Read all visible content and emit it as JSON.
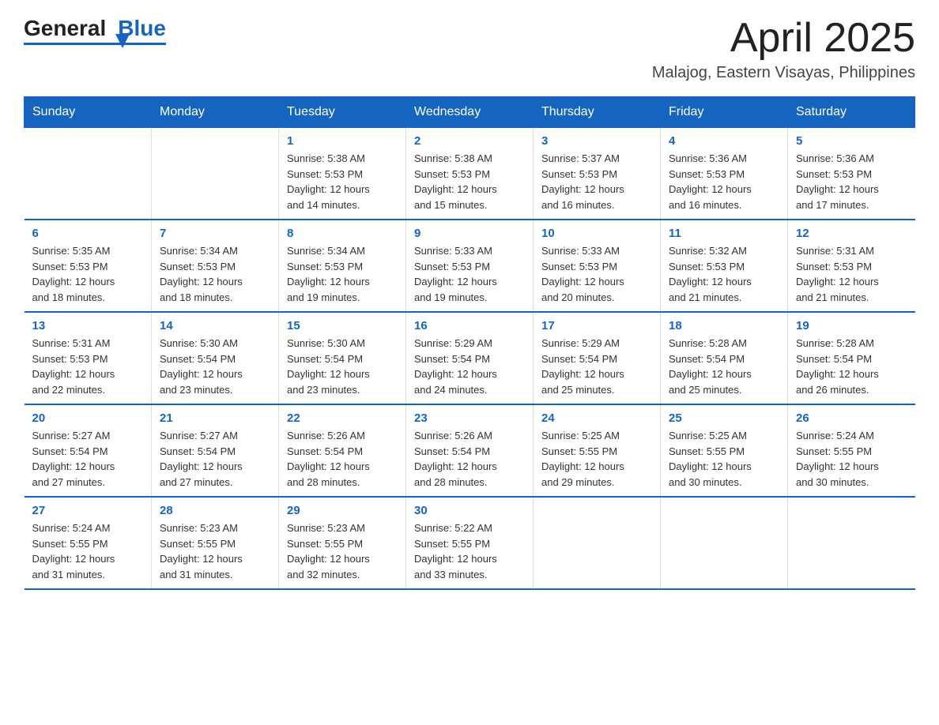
{
  "header": {
    "logo_general": "General",
    "logo_blue": "Blue",
    "month_title": "April 2025",
    "location": "Malajog, Eastern Visayas, Philippines"
  },
  "days_of_week": [
    "Sunday",
    "Monday",
    "Tuesday",
    "Wednesday",
    "Thursday",
    "Friday",
    "Saturday"
  ],
  "weeks": [
    [
      {
        "day": "",
        "info": ""
      },
      {
        "day": "",
        "info": ""
      },
      {
        "day": "1",
        "info": "Sunrise: 5:38 AM\nSunset: 5:53 PM\nDaylight: 12 hours\nand 14 minutes."
      },
      {
        "day": "2",
        "info": "Sunrise: 5:38 AM\nSunset: 5:53 PM\nDaylight: 12 hours\nand 15 minutes."
      },
      {
        "day": "3",
        "info": "Sunrise: 5:37 AM\nSunset: 5:53 PM\nDaylight: 12 hours\nand 16 minutes."
      },
      {
        "day": "4",
        "info": "Sunrise: 5:36 AM\nSunset: 5:53 PM\nDaylight: 12 hours\nand 16 minutes."
      },
      {
        "day": "5",
        "info": "Sunrise: 5:36 AM\nSunset: 5:53 PM\nDaylight: 12 hours\nand 17 minutes."
      }
    ],
    [
      {
        "day": "6",
        "info": "Sunrise: 5:35 AM\nSunset: 5:53 PM\nDaylight: 12 hours\nand 18 minutes."
      },
      {
        "day": "7",
        "info": "Sunrise: 5:34 AM\nSunset: 5:53 PM\nDaylight: 12 hours\nand 18 minutes."
      },
      {
        "day": "8",
        "info": "Sunrise: 5:34 AM\nSunset: 5:53 PM\nDaylight: 12 hours\nand 19 minutes."
      },
      {
        "day": "9",
        "info": "Sunrise: 5:33 AM\nSunset: 5:53 PM\nDaylight: 12 hours\nand 19 minutes."
      },
      {
        "day": "10",
        "info": "Sunrise: 5:33 AM\nSunset: 5:53 PM\nDaylight: 12 hours\nand 20 minutes."
      },
      {
        "day": "11",
        "info": "Sunrise: 5:32 AM\nSunset: 5:53 PM\nDaylight: 12 hours\nand 21 minutes."
      },
      {
        "day": "12",
        "info": "Sunrise: 5:31 AM\nSunset: 5:53 PM\nDaylight: 12 hours\nand 21 minutes."
      }
    ],
    [
      {
        "day": "13",
        "info": "Sunrise: 5:31 AM\nSunset: 5:53 PM\nDaylight: 12 hours\nand 22 minutes."
      },
      {
        "day": "14",
        "info": "Sunrise: 5:30 AM\nSunset: 5:54 PM\nDaylight: 12 hours\nand 23 minutes."
      },
      {
        "day": "15",
        "info": "Sunrise: 5:30 AM\nSunset: 5:54 PM\nDaylight: 12 hours\nand 23 minutes."
      },
      {
        "day": "16",
        "info": "Sunrise: 5:29 AM\nSunset: 5:54 PM\nDaylight: 12 hours\nand 24 minutes."
      },
      {
        "day": "17",
        "info": "Sunrise: 5:29 AM\nSunset: 5:54 PM\nDaylight: 12 hours\nand 25 minutes."
      },
      {
        "day": "18",
        "info": "Sunrise: 5:28 AM\nSunset: 5:54 PM\nDaylight: 12 hours\nand 25 minutes."
      },
      {
        "day": "19",
        "info": "Sunrise: 5:28 AM\nSunset: 5:54 PM\nDaylight: 12 hours\nand 26 minutes."
      }
    ],
    [
      {
        "day": "20",
        "info": "Sunrise: 5:27 AM\nSunset: 5:54 PM\nDaylight: 12 hours\nand 27 minutes."
      },
      {
        "day": "21",
        "info": "Sunrise: 5:27 AM\nSunset: 5:54 PM\nDaylight: 12 hours\nand 27 minutes."
      },
      {
        "day": "22",
        "info": "Sunrise: 5:26 AM\nSunset: 5:54 PM\nDaylight: 12 hours\nand 28 minutes."
      },
      {
        "day": "23",
        "info": "Sunrise: 5:26 AM\nSunset: 5:54 PM\nDaylight: 12 hours\nand 28 minutes."
      },
      {
        "day": "24",
        "info": "Sunrise: 5:25 AM\nSunset: 5:55 PM\nDaylight: 12 hours\nand 29 minutes."
      },
      {
        "day": "25",
        "info": "Sunrise: 5:25 AM\nSunset: 5:55 PM\nDaylight: 12 hours\nand 30 minutes."
      },
      {
        "day": "26",
        "info": "Sunrise: 5:24 AM\nSunset: 5:55 PM\nDaylight: 12 hours\nand 30 minutes."
      }
    ],
    [
      {
        "day": "27",
        "info": "Sunrise: 5:24 AM\nSunset: 5:55 PM\nDaylight: 12 hours\nand 31 minutes."
      },
      {
        "day": "28",
        "info": "Sunrise: 5:23 AM\nSunset: 5:55 PM\nDaylight: 12 hours\nand 31 minutes."
      },
      {
        "day": "29",
        "info": "Sunrise: 5:23 AM\nSunset: 5:55 PM\nDaylight: 12 hours\nand 32 minutes."
      },
      {
        "day": "30",
        "info": "Sunrise: 5:22 AM\nSunset: 5:55 PM\nDaylight: 12 hours\nand 33 minutes."
      },
      {
        "day": "",
        "info": ""
      },
      {
        "day": "",
        "info": ""
      },
      {
        "day": "",
        "info": ""
      }
    ]
  ]
}
